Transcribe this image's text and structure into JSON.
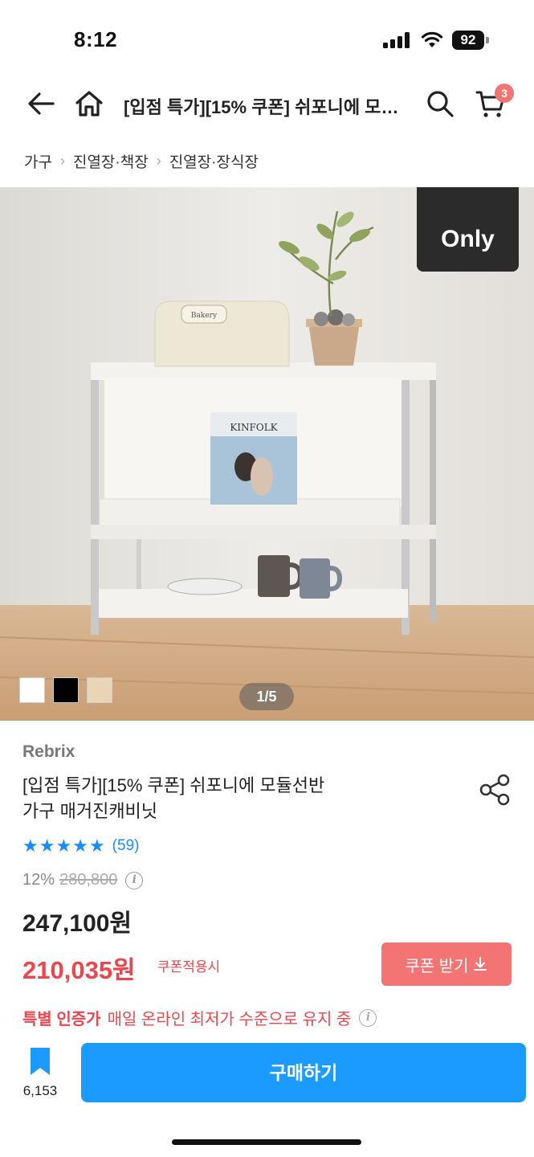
{
  "status_bar": {
    "time": "8:12",
    "battery": "92"
  },
  "header": {
    "title": "[입점 특가][15% 쿠폰] 쉬포니에 모듈선반 가구 매거진캐비닛",
    "cart_count": "3"
  },
  "breadcrumb": [
    "가구",
    "진열장·책장",
    "진열장·장식장"
  ],
  "image": {
    "badge": "Only",
    "magazine_title": "KINFOLK",
    "breadbox_label": "Bakery",
    "page_indicator": "1/5",
    "swatches": [
      "#ffffff",
      "#000000",
      "#e9d4b6"
    ]
  },
  "product": {
    "brand": "Rebrix",
    "title_line1": "[입점 특가][15% 쿠폰] 쉬포니에 모듈선반",
    "title_line2": "가구 매거진캐비닛",
    "rating": 5,
    "review_count": "(59)",
    "discount_rate": "12%",
    "original_price": "280,800",
    "sale_price": "247,100원",
    "coupon_price": "210,035원",
    "coupon_note": "쿠폰적용시",
    "coupon_button": "쿠폰 받기",
    "promo_strong": "특별 인증가",
    "promo_text": "매일 온라인 최저가 수준으로 유지 중"
  },
  "bottom_bar": {
    "bookmark_count": "6,153",
    "buy_label": "구매하기"
  },
  "colors": {
    "accent_blue": "#1b9aff",
    "coupon_red": "#e8474d",
    "coupon_button": "#f27573"
  }
}
